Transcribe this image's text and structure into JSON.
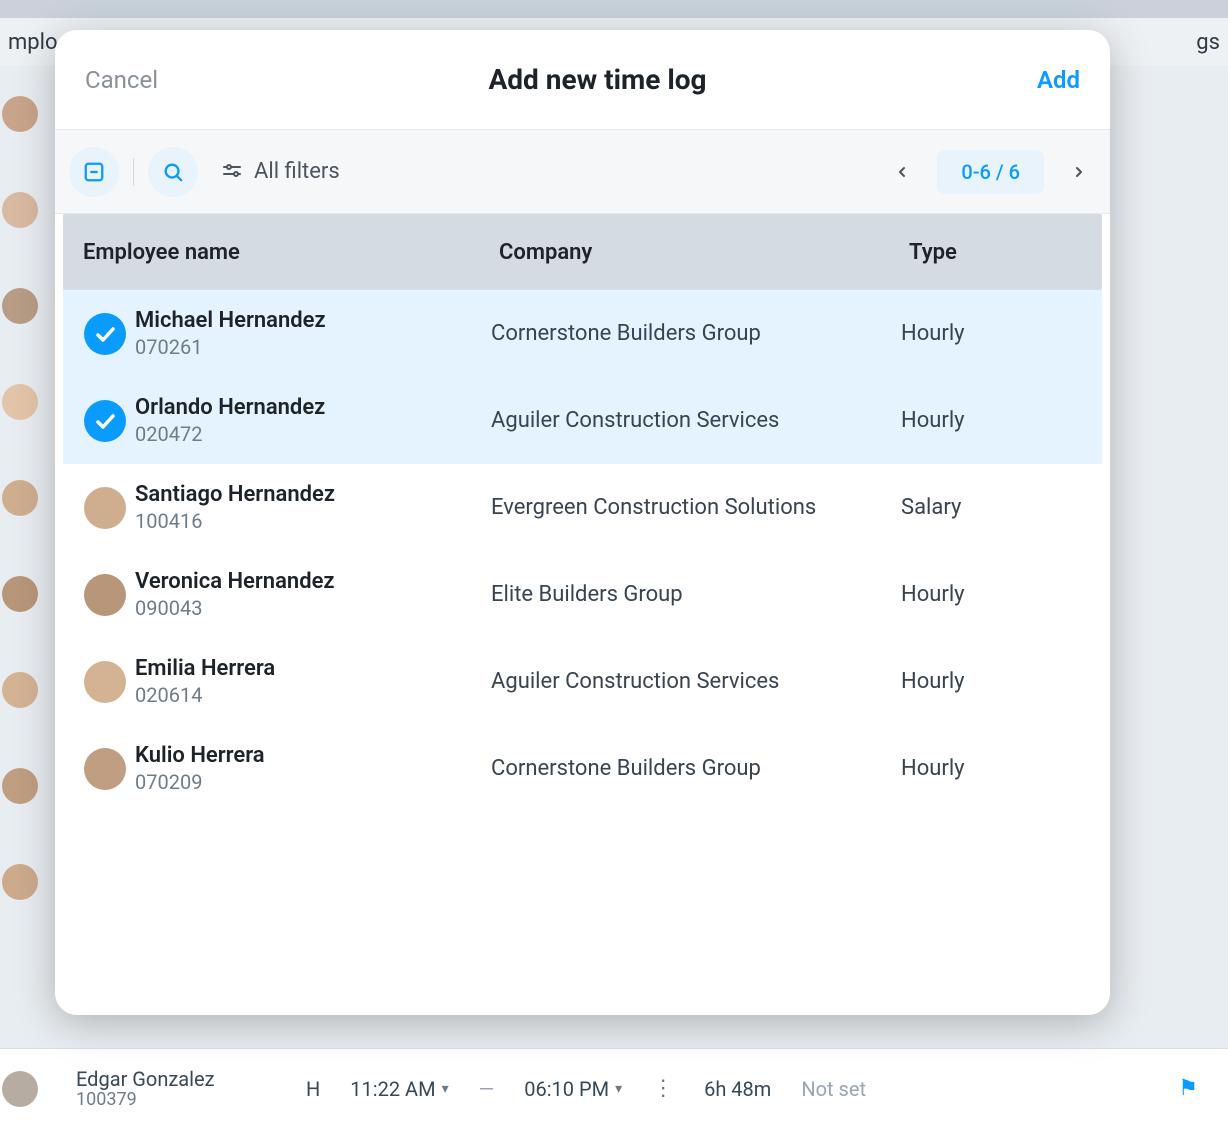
{
  "background": {
    "left_label": "mplo",
    "right_label": "gs",
    "bottom_row": {
      "name": "Edgar Gonzalez",
      "id": "100379",
      "code": "H",
      "time_in": "11:22 AM",
      "time_out": "06:10 PM",
      "separator": "—",
      "duration": "6h 48m",
      "cost": "Not set"
    }
  },
  "modal": {
    "cancel_label": "Cancel",
    "title": "Add new time log",
    "add_label": "Add",
    "toolbar": {
      "filters_label": "All filters",
      "page_indicator": "0-6 / 6"
    },
    "columns": {
      "employee": "Employee name",
      "company": "Company",
      "type": "Type"
    },
    "rows": [
      {
        "name": "Michael Hernandez",
        "id": "070261",
        "company": "Cornerstone Builders Group",
        "type": "Hourly",
        "selected": true
      },
      {
        "name": "Orlando Hernandez",
        "id": "020472",
        "company": "Aguiler Construction Services",
        "type": "Hourly",
        "selected": true
      },
      {
        "name": "Santiago Hernandez",
        "id": "100416",
        "company": "Evergreen Construction Solutions",
        "type": "Salary",
        "selected": false
      },
      {
        "name": "Veronica Hernandez",
        "id": "090043",
        "company": "Elite Builders Group",
        "type": "Hourly",
        "selected": false
      },
      {
        "name": "Emilia Herrera",
        "id": "020614",
        "company": "Aguiler Construction Services",
        "type": "Hourly",
        "selected": false
      },
      {
        "name": "Kulio Herrera",
        "id": "070209",
        "company": "Cornerstone Builders Group",
        "type": "Hourly",
        "selected": false
      }
    ]
  },
  "avatar_colors": [
    "#c9a48a",
    "#d8b9a1",
    "#b79d86",
    "#e2c5a8",
    "#cfae8f",
    "#b8967a",
    "#d4b294",
    "#c09e82",
    "#cdaa8c"
  ]
}
